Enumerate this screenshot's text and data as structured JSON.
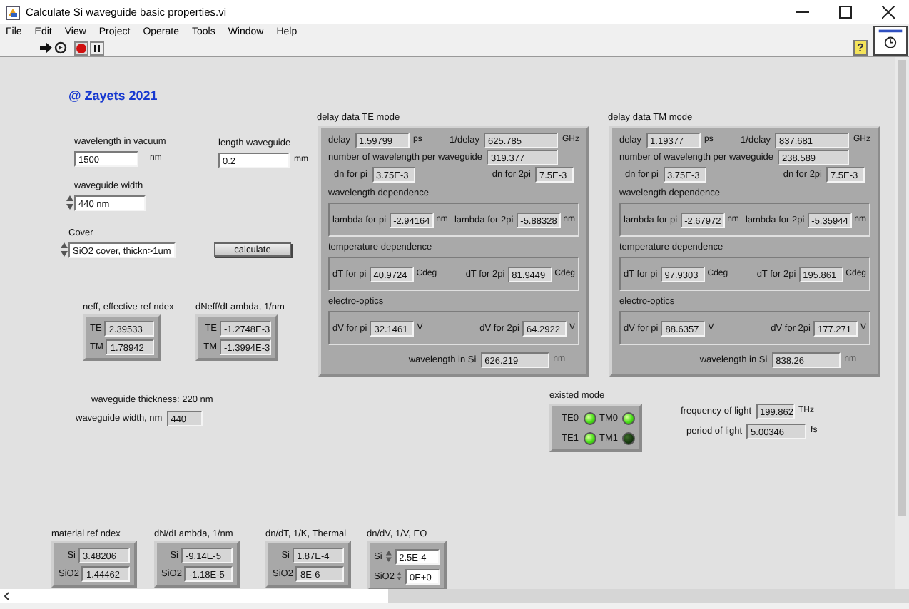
{
  "window": {
    "title": "Calculate Si waveguide basic properties.vi"
  },
  "menu": [
    "File",
    "Edit",
    "View",
    "Project",
    "Operate",
    "Tools",
    "Window",
    "Help"
  ],
  "toolbar": {
    "help": "?"
  },
  "credit": "@ Zayets 2021",
  "inputs": [
    {
      "label": "wavelength in vacuum",
      "value": "1500",
      "unit": "nm"
    },
    {
      "label": "length waveguide",
      "value": "0.2",
      "unit": "mm"
    }
  ],
  "rings": [
    {
      "label": "waveguide width",
      "value": "440 nm"
    },
    {
      "label": "Cover",
      "value": "SiO2 cover, thickn>1um"
    }
  ],
  "calculate_button": "calculate",
  "neff": {
    "title": "neff, effective ref ndex",
    "rows": [
      {
        "label": "TE",
        "value": "2.39533"
      },
      {
        "label": "TM",
        "value": "1.78942"
      }
    ]
  },
  "dneff": {
    "title": "dNeff/dLambda, 1/nm",
    "rows": [
      {
        "label": "TE",
        "value": "-1.2748E-3"
      },
      {
        "label": "TM",
        "value": "-1.3994E-3"
      }
    ]
  },
  "thickness_note": "waveguide thickness: 220 nm",
  "width_indicator": {
    "label": "waveguide width, nm",
    "value": "440"
  },
  "delay_panels": [
    {
      "title": "delay data TE mode",
      "delay": {
        "label": "delay",
        "value": "1.59799",
        "unit": "ps"
      },
      "inverse": {
        "label": "1/delay",
        "value": "625.785",
        "unit": "GHz"
      },
      "count": {
        "label": "number of wavelength per waveguide",
        "value": "319.377"
      },
      "dn_pi": {
        "label": "dn for pi",
        "value": "3.75E-3"
      },
      "dn_2pi": {
        "label": "dn for 2pi",
        "value": "7.5E-3"
      },
      "sections": [
        {
          "title": "wavelength dependence",
          "fields": [
            {
              "label": "lambda for pi",
              "value": "-2.94164",
              "unit": "nm"
            },
            {
              "label": "lambda for 2pi",
              "value": "-5.88328",
              "unit": "nm"
            }
          ]
        },
        {
          "title": "temperature dependence",
          "fields": [
            {
              "label": "dT for pi",
              "value": "40.9724",
              "unit": "Cdeg"
            },
            {
              "label": "dT for 2pi",
              "value": "81.9449",
              "unit": "Cdeg"
            }
          ]
        },
        {
          "title": "electro-optics",
          "fields": [
            {
              "label": "dV for pi",
              "value": "32.1461",
              "unit": "V"
            },
            {
              "label": "dV for 2pi",
              "value": "64.2922",
              "unit": "V"
            }
          ]
        }
      ],
      "wavelength_si": {
        "label": "wavelength in Si",
        "value": "626.219",
        "unit": "nm"
      }
    },
    {
      "title": "delay data TM mode",
      "delay": {
        "label": "delay",
        "value": "1.19377",
        "unit": "ps"
      },
      "inverse": {
        "label": "1/delay",
        "value": "837.681",
        "unit": "GHz"
      },
      "count": {
        "label": "number of wavelength per waveguide",
        "value": "238.589"
      },
      "dn_pi": {
        "label": "dn for pi",
        "value": "3.75E-3"
      },
      "dn_2pi": {
        "label": "dn for 2pi",
        "value": "7.5E-3"
      },
      "sections": [
        {
          "title": "wavelength dependence",
          "fields": [
            {
              "label": "lambda for pi",
              "value": "-2.67972",
              "unit": "nm"
            },
            {
              "label": "lambda for 2pi",
              "value": "-5.35944",
              "unit": "nm"
            }
          ]
        },
        {
          "title": "temperature dependence",
          "fields": [
            {
              "label": "dT for pi",
              "value": "97.9303",
              "unit": "Cdeg"
            },
            {
              "label": "dT for 2pi",
              "value": "195.861",
              "unit": "Cdeg"
            }
          ]
        },
        {
          "title": "electro-optics",
          "fields": [
            {
              "label": "dV for pi",
              "value": "88.6357",
              "unit": "V"
            },
            {
              "label": "dV for 2pi",
              "value": "177.271",
              "unit": "V"
            }
          ]
        }
      ],
      "wavelength_si": {
        "label": "wavelength in Si",
        "value": "838.26",
        "unit": "nm"
      }
    }
  ],
  "modes": {
    "title": "existed mode",
    "leds": [
      {
        "label": "TE0",
        "on": true
      },
      {
        "label": "TM0",
        "on": true
      },
      {
        "label": "TE1",
        "on": true
      },
      {
        "label": "TM1",
        "on": false
      }
    ]
  },
  "frequency": {
    "label": "frequency of  light",
    "value": "199.862",
    "unit": "THz"
  },
  "period": {
    "label": "period of light",
    "value": "5.00346",
    "unit": "fs"
  },
  "materials": [
    {
      "title": "material ref ndex",
      "kind": "indicator",
      "rows": [
        {
          "label": "Si",
          "value": "3.48206"
        },
        {
          "label": "SiO2",
          "value": "1.44462"
        }
      ]
    },
    {
      "title": "dN/dLambda, 1/nm",
      "kind": "indicator",
      "rows": [
        {
          "label": "Si",
          "value": "-9.14E-5"
        },
        {
          "label": "SiO2",
          "value": "-1.18E-5"
        }
      ]
    },
    {
      "title": "dn/dT, 1/K, Thermal",
      "kind": "indicator",
      "rows": [
        {
          "label": "Si",
          "value": "1.87E-4"
        },
        {
          "label": "SiO2",
          "value": "8E-6"
        }
      ]
    },
    {
      "title": "dn/dV, 1/V, EO",
      "kind": "control",
      "rows": [
        {
          "label": "Si",
          "value": "2.5E-4"
        },
        {
          "label": "SiO2",
          "value": "0E+0"
        }
      ]
    }
  ]
}
